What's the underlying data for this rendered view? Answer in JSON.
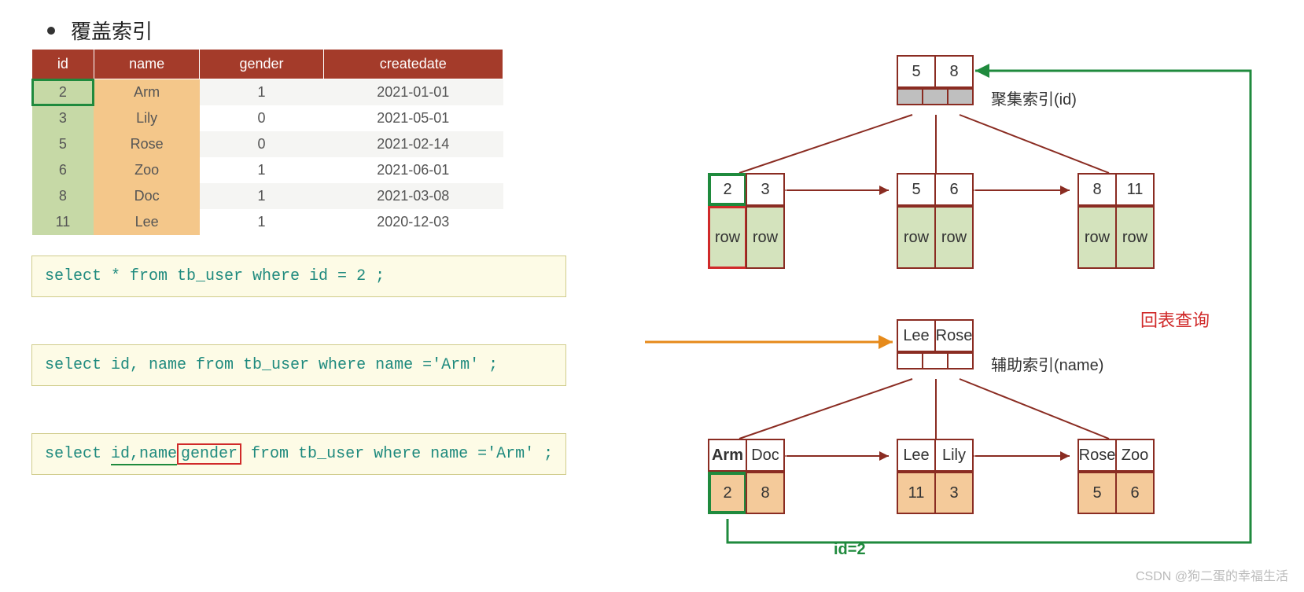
{
  "title": "覆盖索引",
  "table": {
    "headers": [
      "id",
      "name",
      "gender",
      "createdate"
    ],
    "rows": [
      {
        "id": "2",
        "name": "Arm",
        "gender": "1",
        "date": "2021-01-01"
      },
      {
        "id": "3",
        "name": "Lily",
        "gender": "0",
        "date": "2021-05-01"
      },
      {
        "id": "5",
        "name": "Rose",
        "gender": "0",
        "date": "2021-02-14"
      },
      {
        "id": "6",
        "name": "Zoo",
        "gender": "1",
        "date": "2021-06-01"
      },
      {
        "id": "8",
        "name": "Doc",
        "gender": "1",
        "date": "2021-03-08"
      },
      {
        "id": "11",
        "name": "Lee",
        "gender": "1",
        "date": "2020-12-03"
      }
    ]
  },
  "sql1": "select * from tb_user where id = 2 ;",
  "sql2": "select id, name from tb_user where name ='Arm' ;",
  "sql3_pre": "select ",
  "sql3_idname": "id,name",
  "sql3_gender": "gender",
  "sql3_post": " from tb_user where name ='Arm' ;",
  "cluster_label": "聚集索引(id)",
  "aux_label": "辅助索引(name)",
  "back_query": "回表查询",
  "id_eq": "id=2",
  "cluster_root": [
    "5",
    "8"
  ],
  "cluster_leaves": [
    {
      "keys": [
        "2",
        "3"
      ],
      "rows": [
        "row",
        "row"
      ]
    },
    {
      "keys": [
        "5",
        "6"
      ],
      "rows": [
        "row",
        "row"
      ]
    },
    {
      "keys": [
        "8",
        "11"
      ],
      "rows": [
        "row",
        "row"
      ]
    }
  ],
  "aux_root": [
    "Lee",
    "Rose"
  ],
  "aux_leaves": [
    {
      "keys": [
        "Arm",
        "Doc"
      ],
      "ids": [
        "2",
        "8"
      ]
    },
    {
      "keys": [
        "Lee",
        "Lily"
      ],
      "ids": [
        "11",
        "3"
      ]
    },
    {
      "keys": [
        "Rose",
        "Zoo"
      ],
      "ids": [
        "5",
        "6"
      ]
    }
  ],
  "watermark": "CSDN @狗二蛋的幸福生活"
}
